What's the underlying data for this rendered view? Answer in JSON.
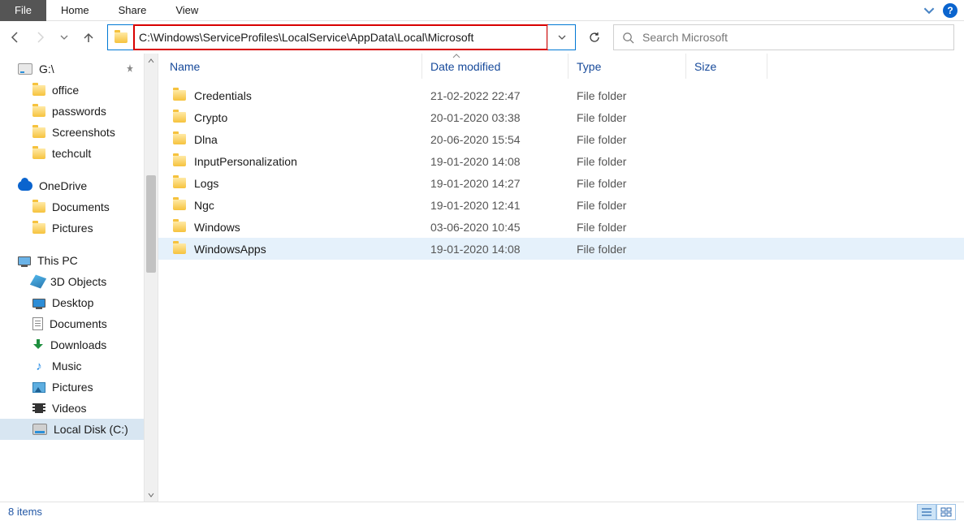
{
  "ribbon": {
    "tabs": {
      "file": "File",
      "home": "Home",
      "share": "Share",
      "view": "View"
    }
  },
  "address": {
    "path": "C:\\Windows\\ServiceProfiles\\LocalService\\AppData\\Local\\Microsoft"
  },
  "search": {
    "placeholder": "Search Microsoft"
  },
  "sidebar": {
    "quick": {
      "drive_label": "G:\\"
    },
    "qa": {
      "office": "office",
      "passwords": "passwords",
      "screenshots": "Screenshots",
      "techcult": "techcult"
    },
    "onedrive": {
      "label": "OneDrive",
      "documents": "Documents",
      "pictures": "Pictures"
    },
    "thispc": {
      "label": "This PC",
      "obj3d": "3D Objects",
      "desktop": "Desktop",
      "documents": "Documents",
      "downloads": "Downloads",
      "music": "Music",
      "pictures": "Pictures",
      "videos": "Videos",
      "localdisk": "Local Disk (C:)"
    }
  },
  "columns": {
    "name": "Name",
    "date": "Date modified",
    "type": "Type",
    "size": "Size"
  },
  "rows": [
    {
      "name": "Credentials",
      "date": "21-02-2022 22:47",
      "type": "File folder"
    },
    {
      "name": "Crypto",
      "date": "20-01-2020 03:38",
      "type": "File folder"
    },
    {
      "name": "Dlna",
      "date": "20-06-2020 15:54",
      "type": "File folder"
    },
    {
      "name": "InputPersonalization",
      "date": "19-01-2020 14:08",
      "type": "File folder"
    },
    {
      "name": "Logs",
      "date": "19-01-2020 14:27",
      "type": "File folder"
    },
    {
      "name": "Ngc",
      "date": "19-01-2020 12:41",
      "type": "File folder"
    },
    {
      "name": "Windows",
      "date": "03-06-2020 10:45",
      "type": "File folder"
    },
    {
      "name": "WindowsApps",
      "date": "19-01-2020 14:08",
      "type": "File folder"
    }
  ],
  "status": {
    "count": "8 items"
  }
}
